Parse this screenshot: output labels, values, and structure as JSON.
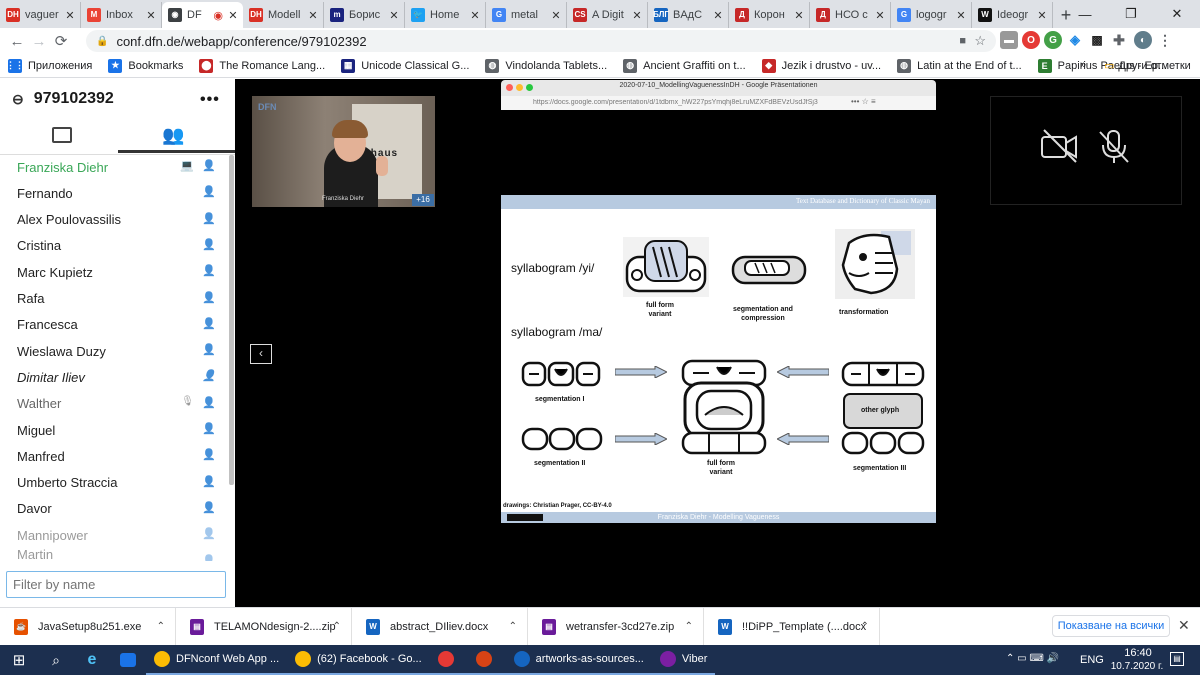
{
  "tabs": [
    {
      "label": "vaguer",
      "icon": "DH",
      "color": "#d93025"
    },
    {
      "label": "Inbox",
      "icon": "M",
      "color": "#ea4335"
    },
    {
      "label": "DF",
      "icon": "◉",
      "color": "#3c4043",
      "recording": true
    },
    {
      "label": "Modell",
      "icon": "DH",
      "color": "#d93025"
    },
    {
      "label": "Борис",
      "icon": "m",
      "color": "#1a237e"
    },
    {
      "label": "Home",
      "icon": "🐦",
      "color": "#1da1f2"
    },
    {
      "label": "metal",
      "icon": "G",
      "color": "#4285f4"
    },
    {
      "label": "A Digit",
      "icon": "CS",
      "color": "#c62828"
    },
    {
      "label": "BAдC",
      "icon": "БЛГ",
      "color": "#1565c0"
    },
    {
      "label": "Корон",
      "icon": "Д",
      "color": "#c62828"
    },
    {
      "label": "НСО с",
      "icon": "Д",
      "color": "#c62828"
    },
    {
      "label": "logogr",
      "icon": "G",
      "color": "#4285f4"
    },
    {
      "label": "Ideogr",
      "icon": "W",
      "color": "#111"
    }
  ],
  "new_tab": "+",
  "window_controls": {
    "minimize": "—",
    "maximize": "❐",
    "close": "✕"
  },
  "url": "conf.dfn.de/webapp/conference/979102392",
  "bookmarks": [
    {
      "label": "Приложения",
      "icon": "⋮⋮",
      "color": "#1a73e8"
    },
    {
      "label": "Bookmarks",
      "icon": "★",
      "color": "#1a73e8"
    },
    {
      "label": "The Romance Lang...",
      "icon": "⬤",
      "color": "#c62828"
    },
    {
      "label": "Unicode Classical G...",
      "icon": "▦",
      "color": "#1a237e"
    },
    {
      "label": "Vindolanda Tablets...",
      "icon": "◍",
      "color": "#5f6368"
    },
    {
      "label": "Ancient Graffiti on t...",
      "icon": "◍",
      "color": "#5f6368"
    },
    {
      "label": "Jezik i drustvo - uv...",
      "icon": "◆",
      "color": "#c62828"
    },
    {
      "label": "Latin at the End of t...",
      "icon": "◍",
      "color": "#5f6368"
    },
    {
      "label": "Papirius Paetus - Ep...",
      "icon": "E",
      "color": "#2e7d32"
    }
  ],
  "bookmarks_more": "»",
  "bookmarks_other": "Други отметки",
  "meeting": {
    "id": "979102392"
  },
  "participants": [
    {
      "name": "Franziska Diehr",
      "style": "presenter"
    },
    {
      "name": "Fernando",
      "style": "normal"
    },
    {
      "name": "Alex Poulovassilis",
      "style": "normal"
    },
    {
      "name": "Cristina",
      "style": "normal"
    },
    {
      "name": "Marc Kupietz",
      "style": "normal"
    },
    {
      "name": "Rafa",
      "style": "normal"
    },
    {
      "name": "Francesca",
      "style": "normal"
    },
    {
      "name": "Wieslawa Duzy",
      "style": "normal"
    },
    {
      "name": "Dimitar Iliev",
      "style": "italic"
    },
    {
      "name": "Walther",
      "style": "muted"
    },
    {
      "name": "Miguel",
      "style": "normal"
    },
    {
      "name": "Manfred",
      "style": "normal"
    },
    {
      "name": "Umberto Straccia",
      "style": "normal"
    },
    {
      "name": "Davor",
      "style": "normal"
    },
    {
      "name": "Mannipower",
      "style": "faded"
    },
    {
      "name": "Martin",
      "style": "faded"
    }
  ],
  "filter_placeholder": "Filter by name",
  "video": {
    "name_label": "Franziska Diehr",
    "more_count": "+16",
    "poster_text": "bauhaus",
    "logo": "DFN"
  },
  "share_window": {
    "title": "2020-07-10_ModellingVaguenessInDH - Google Präsentationen",
    "url": "https://docs.google.com/presentation/d/1tdbmx_hW227psYmqhj8eLruMZXFdBEVzUsdJfSj3"
  },
  "slide": {
    "header": "Text Database and Dictionary of Classic Mayan",
    "syll_yi": "syllabogram /yi/",
    "syll_ma": "syllabogram /ma/",
    "full_form_variant": "full form\nvariant",
    "seg_compression": "segmentation and\ncompression",
    "transformation": "transformation",
    "seg1": "segmentation I",
    "seg2": "segmentation II",
    "seg3": "segmentation III",
    "other_glyph": "other glyph",
    "full_form_variant2": "full form\nvariant",
    "credit": "drawings: Christian Prager, CC-BY-4.0",
    "footer": "Franziska Diehr - Modelling Vagueness"
  },
  "downloads": [
    {
      "name": "JavaSetup8u251.exe",
      "icon": "☕",
      "color": "#e65100"
    },
    {
      "name": "TELAMONdesign-2....zip",
      "icon": "▤",
      "color": "#6a1b9a"
    },
    {
      "name": "abstract_DIliev.docx",
      "icon": "W",
      "color": "#1565c0"
    },
    {
      "name": "wetransfer-3cd27e.zip",
      "icon": "▤",
      "color": "#6a1b9a"
    },
    {
      "name": "!!DiPP_Template (....docx",
      "icon": "W",
      "color": "#1565c0"
    }
  ],
  "downloads_show_all": "Показване на всички",
  "taskbar": {
    "apps": [
      {
        "label": "DFNconf Web App ...",
        "color": "#fbbc04"
      },
      {
        "label": "(62) Facebook - Go...",
        "color": "#fbbc04"
      },
      {
        "label": "",
        "color": "#e53935"
      },
      {
        "label": "",
        "color": "#d84315"
      },
      {
        "label": "artworks-as-sources...",
        "color": "#1565c0"
      },
      {
        "label": "Viber",
        "color": "#7b1fa2"
      }
    ],
    "lang": "ENG",
    "time": "16:40",
    "date": "10.7.2020 г."
  }
}
